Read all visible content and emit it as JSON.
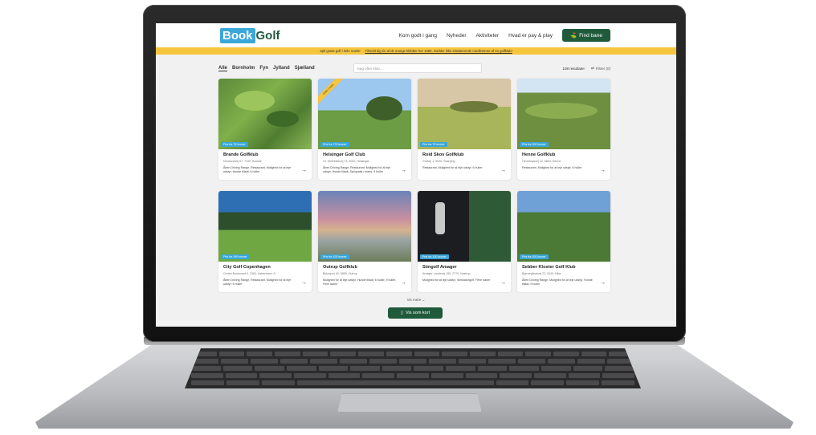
{
  "nav": {
    "logo_book": "Book",
    "logo_golf": "Golf",
    "links": [
      "Kom godt i gang",
      "Nyheder",
      "Aktiviteter",
      "Hvad er pay & play"
    ],
    "cta": "Find bane"
  },
  "banner": {
    "text": "Spil gratis golf i hele marts!",
    "link": "Tilmeld dig én af de mange klubber her 1080, Gælder ikke eksisterende medlemmer af en golfklub!"
  },
  "filters": {
    "regions": [
      "Alle",
      "Bornholm",
      "Fyn",
      "Jylland",
      "Sjælland"
    ],
    "search_placeholder": "Søg efter klub...",
    "results": "108 resultater",
    "filter_label": "Filtrer (0)"
  },
  "clubs": [
    {
      "name": "Brande Golfklub",
      "addr": "Nordlundvej 67, 7330, Brande",
      "features": "Åben Driving Range, Restaurant, Mulighed for at leje udstyr, Hunde tilladt, 6 huller",
      "price": "Pris fra 75 kroner"
    },
    {
      "name": "Helsingør Golf Club",
      "addr": "Gl. Hellebækvej 73, 3000, Helsingør",
      "features": "Åben Driving Range, Restaurant, Mulighed for at leje udstyr, Hunde tilladt, Spil gratis i marts, 9 huller",
      "price": "Pris fra 175 kroner",
      "ribbon": "Gratis i marts"
    },
    {
      "name": "Roid Skov Golfklub",
      "addr": "Golfvej 1, 9520, Skørping",
      "features": "Restaurant, Mulighed for at leje udstyr, 6 huller",
      "price": "Pris fra 75 kroner"
    },
    {
      "name": "Henne Golfklub",
      "addr": "Hennebysvej 22, 6854, Henne",
      "features": "Restaurant, Mulighed for at leje udstyr, 6 huller",
      "price": "Pris fra 100 kroner"
    },
    {
      "name": "City Golf Copenhagen",
      "addr": "Center Boulevard 6, 2300, København S",
      "features": "Åben Driving Range, Restaurant, Mulighed for at leje udstyr, 6 huller",
      "price": "Pris fra 399 kroner"
    },
    {
      "name": "Outrup Golfklub",
      "addr": "Birkerjvej 40, 6855, Outrup",
      "features": "Mulighed for at leje udstyr, Hunde tilladt, 6 huller, 9 huller, Flere baner",
      "price": "Pris fra 100 kroner"
    },
    {
      "name": "Simgolf Amager",
      "addr": "Amager Landevej 155, 2770, Kastrup",
      "features": "Mulighed for at leje udstyr, Simulatorgolf, Flere baner",
      "price": "Pris fra 100 kroner"
    },
    {
      "name": "Sebber Kloster Golf Klub",
      "addr": "Bjørnegårdsvej 23, 9240, Nibe",
      "features": "Åben Driving Range, Mulighed for at leje udstyr, Hunde tilladt, 9 huller",
      "price": "Pris fra 100 kroner"
    }
  ],
  "more_label": "Vis mere",
  "map_button": "Vis som kort"
}
